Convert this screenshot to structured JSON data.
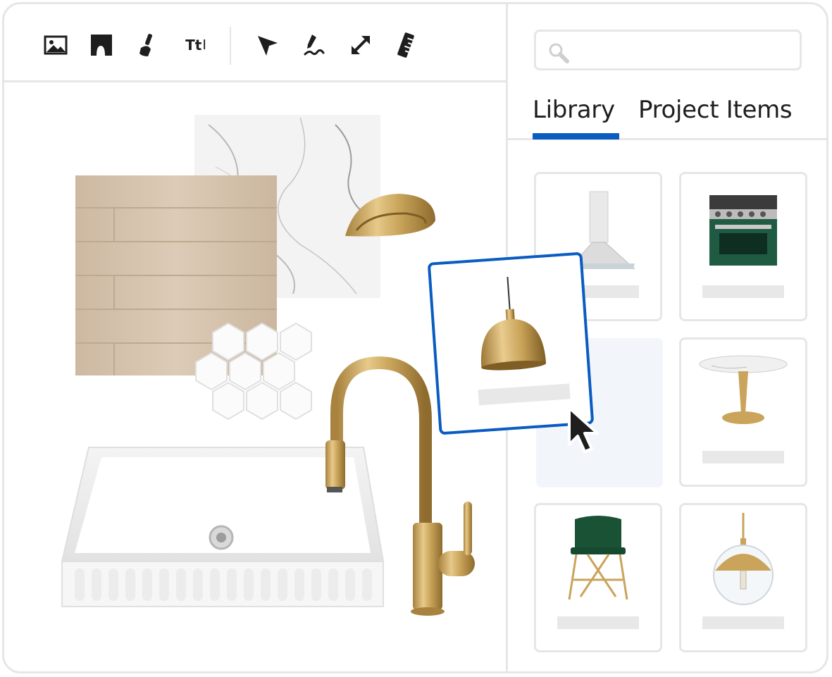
{
  "toolbar": {
    "tools": [
      {
        "name": "image-tool",
        "icon": "image-icon"
      },
      {
        "name": "shape-tool",
        "icon": "arch-shape-icon"
      },
      {
        "name": "brush-tool",
        "icon": "paintbrush-icon"
      },
      {
        "name": "text-tool",
        "icon": "text-icon",
        "label": "Tt"
      },
      {
        "name": "select-tool",
        "icon": "pointer-arrow-icon"
      },
      {
        "name": "draw-tool",
        "icon": "pen-scribble-icon"
      },
      {
        "name": "resize-tool",
        "icon": "diagonal-resize-icon"
      },
      {
        "name": "measure-tool",
        "icon": "ruler-icon"
      }
    ]
  },
  "search": {
    "value": "",
    "placeholder": ""
  },
  "tabs": [
    {
      "label": "Library",
      "active": true
    },
    {
      "label": "Project Items",
      "active": false
    }
  ],
  "library_items": [
    {
      "icon": "range-hood-icon"
    },
    {
      "icon": "green-range-oven-icon"
    },
    {
      "icon": "placeholder-slot"
    },
    {
      "icon": "marble-tulip-table-icon"
    },
    {
      "icon": "green-bar-stool-icon"
    },
    {
      "icon": "globe-pendant-light-icon"
    }
  ],
  "dragged_item": {
    "icon": "brass-dome-pendant-icon"
  },
  "colors": {
    "accent": "#0a5cc2",
    "border": "#e6e6e6",
    "gold": "#c9a45a",
    "green": "#1f5a43",
    "text": "#1e1e1e"
  }
}
